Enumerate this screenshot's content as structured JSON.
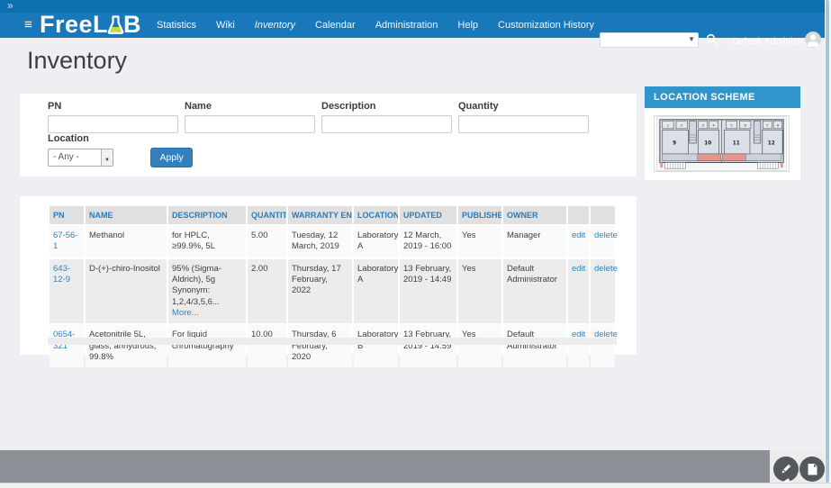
{
  "header": {
    "expand_icon": "»",
    "menu_icon": "≡",
    "logo": {
      "part1": "Free",
      "part2": "L",
      "part3": "B"
    },
    "nav": [
      {
        "label": "Statistics"
      },
      {
        "label": "Wiki"
      },
      {
        "label": "Inventory",
        "active": true
      },
      {
        "label": "Calendar"
      },
      {
        "label": "Administration"
      },
      {
        "label": "Help"
      },
      {
        "label": "Customization History"
      }
    ],
    "search": {
      "value": "",
      "dropdown_icon": "▼"
    },
    "user": {
      "name": "Default Administrator"
    }
  },
  "page": {
    "title": "Inventory"
  },
  "filters": {
    "pn_label": "PN",
    "name_label": "Name",
    "description_label": "Description",
    "quantity_label": "Quantity",
    "location_label": "Location",
    "location_value": "- Any -",
    "apply_label": "Apply",
    "pn_value": "",
    "name_value": "",
    "description_value": "",
    "quantity_value": ""
  },
  "table": {
    "columns": [
      "PN",
      "NAME",
      "DESCRIPTION",
      "QUANTITY",
      "WARRANTY END",
      "LOCATION",
      "UPDATED",
      "PUBLISHED",
      "OWNER"
    ],
    "rows": [
      {
        "pn": "67-56-1",
        "name": "Methanol",
        "description": "for HPLC, ≥99.9%, 5L",
        "more": "",
        "quantity": "5.00",
        "warranty_end": "Tuesday, 12 March, 2019",
        "location": "Laboratory A",
        "updated": "12 March, 2019 - 16:00",
        "published": "Yes",
        "owner": "Manager",
        "edit_label": "edit",
        "delete_label": "delete"
      },
      {
        "pn": "643-12-9",
        "name": "D-(+)-chiro-Inositol",
        "description": "95% (Sigma-Aldrich), 5g\nSynonym:\n1,2,4/3,5,6... ",
        "more": "More...",
        "quantity": "2.00",
        "warranty_end": "Thursday, 17 February, 2022",
        "location": "Laboratory A",
        "updated": "13 February, 2019 - 14:49",
        "published": "Yes",
        "owner": "Default Administrator",
        "edit_label": "edit",
        "delete_label": "delete"
      },
      {
        "pn": "0654-321",
        "name": "Acetonitrile 5L, glass, anhydrous, 99.8%",
        "description": "For liquid chromatography",
        "more": "",
        "quantity": "10.00",
        "warranty_end": "Thursday, 6 February, 2020",
        "location": "Laboratory B",
        "updated": "13 February, 2019 - 14:59",
        "published": "Yes",
        "owner": "Default Administrator",
        "edit_label": "edit",
        "delete_label": "delete"
      }
    ]
  },
  "sidebar": {
    "title": "LOCATION SCHEME",
    "floorplan": {
      "small_rooms": [
        "1",
        "2",
        "3",
        "4",
        "5",
        "6",
        "7",
        "8"
      ],
      "large_rooms": [
        "9",
        "10",
        "11",
        "12"
      ],
      "highlight_color": "#e8948c"
    }
  },
  "colors": {
    "top_strip": "#0d6fae",
    "navbar": "#1878b9",
    "page_bg": "#edeff3",
    "accent_blue": "#3383bd",
    "panel_header_bg": "#3095cb",
    "table_header_text": "#2b7cb8",
    "row_alt_bg": "#ececec",
    "footer_bar": "#8c9096",
    "fab_bg": "#54575b",
    "flask_liquid": "#c9d83a"
  }
}
